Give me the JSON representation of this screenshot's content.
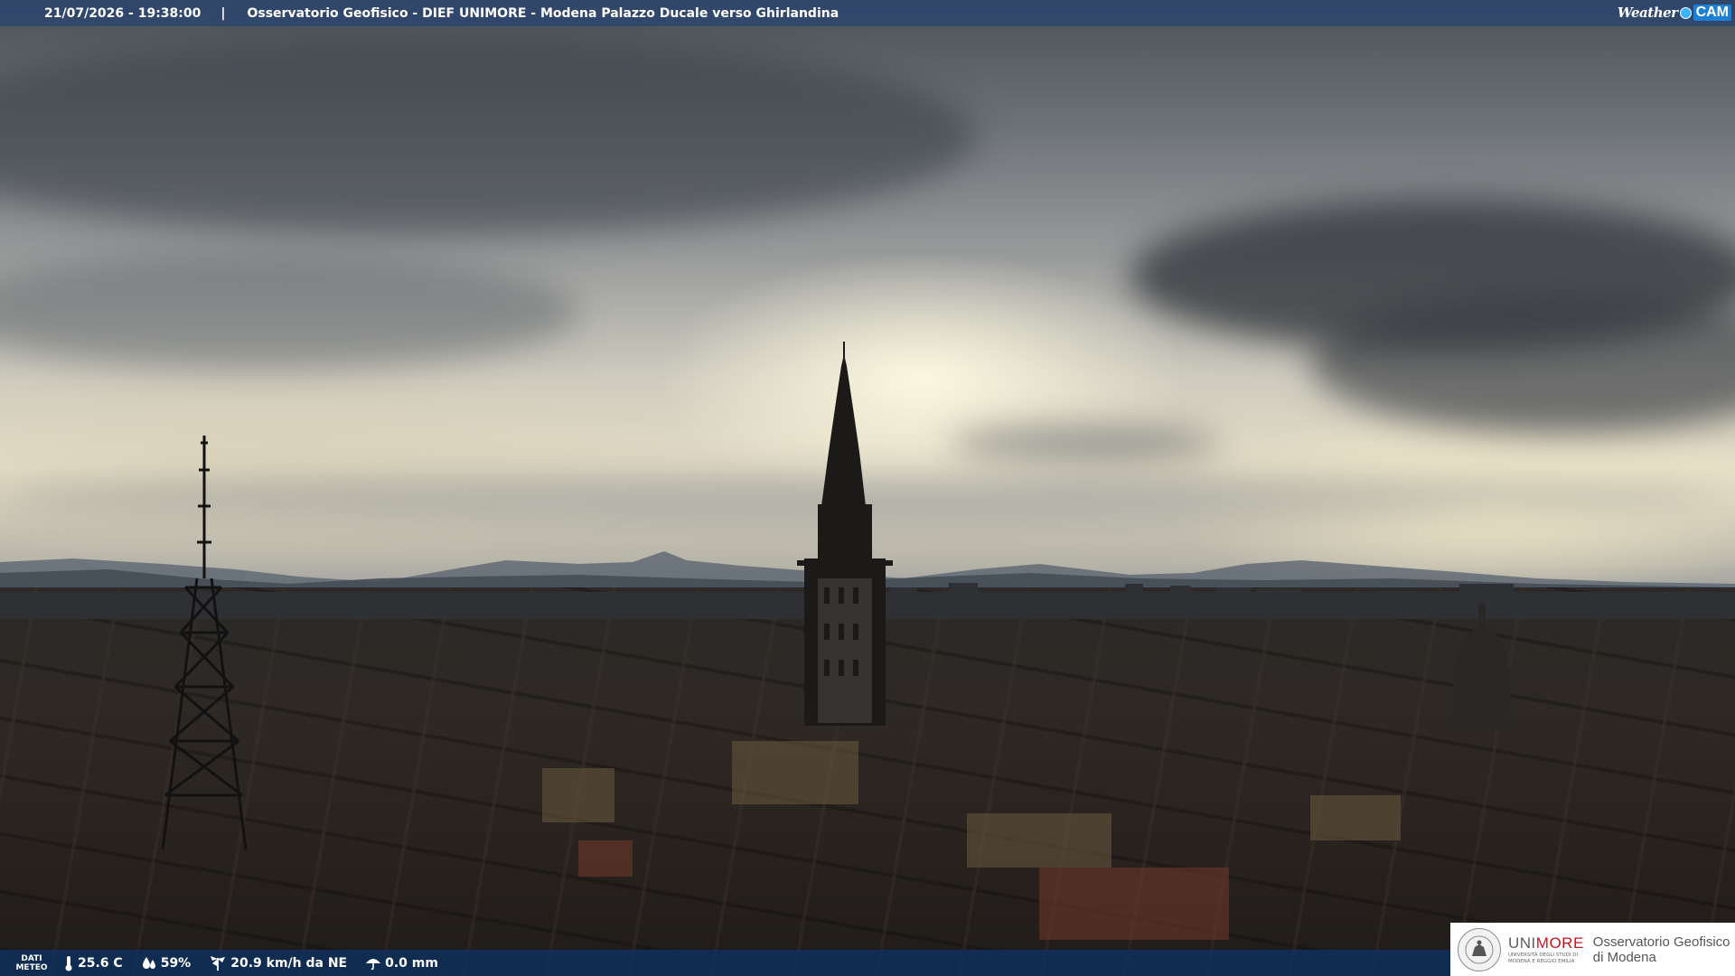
{
  "header": {
    "datetime": "21/07/2026 - 19:38:00",
    "separator": "|",
    "title": "Osservatorio Geofisico - DIEF UNIMORE - Modena Palazzo Ducale verso Ghirlandina",
    "brand_weather": "Weather",
    "brand_cam": "CAM"
  },
  "weather": {
    "label_line1": "DATI",
    "label_line2": "METEO",
    "temperature": "25.6 C",
    "humidity": "59%",
    "wind": "20.9 km/h da NE",
    "rain": "0.0 mm"
  },
  "logo": {
    "uni_part1": "UNI",
    "uni_part2": "MORE",
    "uni_sub1": "UNIVERSITÀ DEGLI STUDI DI",
    "uni_sub2": "MODENA E REGGIO EMILIA",
    "observatory_line1": "Osservatorio Geofisico",
    "observatory_line2": "di Modena"
  },
  "colors": {
    "topbar": "#284470",
    "bottombar": "#0e305c",
    "unimore_red": "#c9141c"
  },
  "icons": [
    "thermometer-icon",
    "humidity-icon",
    "wind-icon",
    "rain-icon",
    "weathercam-logo"
  ]
}
